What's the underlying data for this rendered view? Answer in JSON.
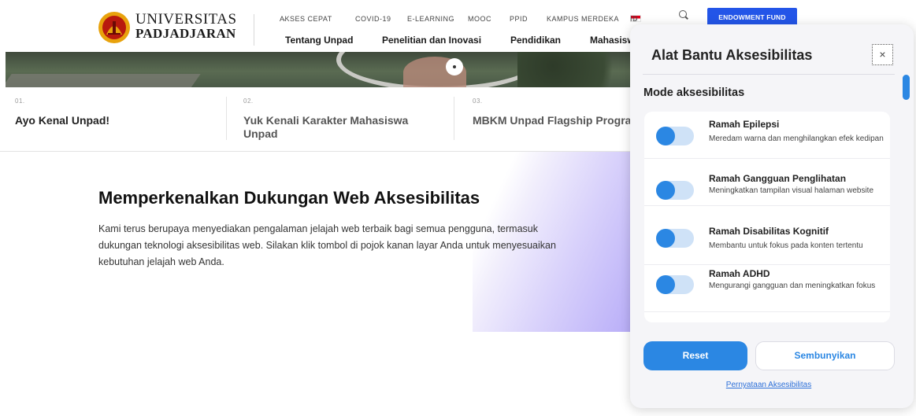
{
  "brand": {
    "line1": "UNIVERSITAS",
    "line2": "PADJADJARAN"
  },
  "topnav": {
    "items": [
      "AKSES CEPAT",
      "COVID-19",
      "E-LEARNING",
      "MOOC",
      "PPID",
      "KAMPUS MERDEKA",
      "ID"
    ],
    "caret": "⌄",
    "endowment": "ENDOWMENT FUND"
  },
  "mainnav": {
    "items": [
      "Tentang Unpad",
      "Penelitian dan Inovasi",
      "Pendidikan",
      "Mahasisw"
    ],
    "caret": "⌄"
  },
  "features": [
    {
      "num": "01.",
      "title": "Ayo Kenal Unpad!"
    },
    {
      "num": "02.",
      "title": "Yuk Kenali Karakter Mahasiswa Unpad"
    },
    {
      "num": "03.",
      "title": "MBKM Unpad Flagship Program"
    }
  ],
  "intro": {
    "title": "Memperkenalkan Dukungan Web Aksesibilitas",
    "text": "Kami terus berupaya menyediakan pengalaman jelajah web terbaik bagi semua pengguna, termasuk dukungan teknologi aksesibilitas web. Silakan klik tombol di pojok kanan layar Anda untuk menyesuaikan kebutuhan jelajah web Anda."
  },
  "panel": {
    "title": "Alat Bantu Aksesibilitas",
    "close": "×",
    "section": "Mode aksesibilitas",
    "modes": [
      {
        "name": "Ramah Epilepsi",
        "desc": "Meredam warna dan menghilangkan efek kedipan",
        "enabled": false
      },
      {
        "name": "Ramah Gangguan Penglihatan",
        "desc": "Meningkatkan tampilan visual halaman website",
        "enabled": false
      },
      {
        "name": "Ramah Disabilitas Kognitif",
        "desc": "Membantu untuk fokus pada konten tertentu",
        "enabled": false
      },
      {
        "name": "Ramah ADHD",
        "desc": "Mengurangi gangguan dan meningkatkan fokus",
        "enabled": false
      }
    ],
    "reset": "Reset",
    "hide": "Sembunyikan",
    "statement": "Pernyataan Aksesibilitas"
  },
  "colors": {
    "accent": "#2b87e3",
    "endowment": "#2355e8",
    "toggle_track": "#cfe2f7"
  }
}
